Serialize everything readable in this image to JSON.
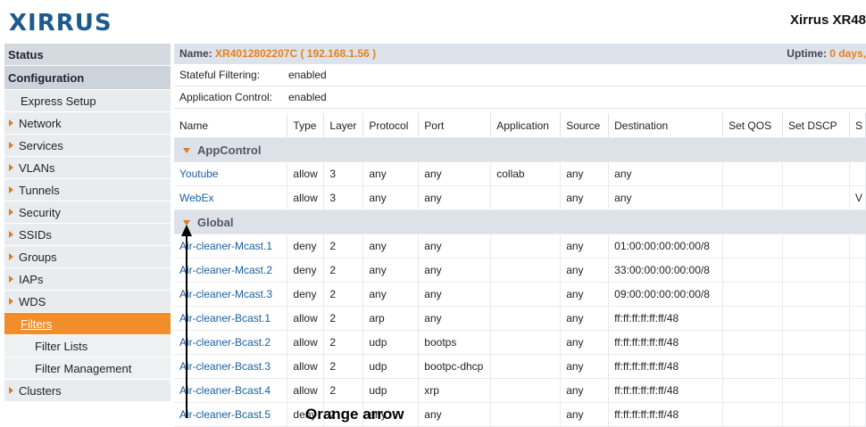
{
  "header": {
    "logo": "XIRRUS",
    "title": "Xirrus XR48"
  },
  "sidebar": {
    "status": "Status",
    "configuration": "Configuration",
    "items": [
      {
        "label": "Express Setup",
        "kind": "sub-plain"
      },
      {
        "label": "Network",
        "kind": "arrow"
      },
      {
        "label": "Services",
        "kind": "arrow"
      },
      {
        "label": "VLANs",
        "kind": "arrow"
      },
      {
        "label": "Tunnels",
        "kind": "arrow"
      },
      {
        "label": "Security",
        "kind": "arrow"
      },
      {
        "label": "SSIDs",
        "kind": "arrow"
      },
      {
        "label": "Groups",
        "kind": "arrow"
      },
      {
        "label": "IAPs",
        "kind": "arrow"
      },
      {
        "label": "WDS",
        "kind": "arrow"
      },
      {
        "label": "Filters",
        "kind": "active"
      },
      {
        "label": "Filter Lists",
        "kind": "sub"
      },
      {
        "label": "Filter Management",
        "kind": "sub"
      },
      {
        "label": "Clusters",
        "kind": "arrow"
      }
    ]
  },
  "info": {
    "name_label": "Name:",
    "name_value": "XR4012802207C",
    "ip": "( 192.168.1.56 )",
    "uptime_label": "Uptime:",
    "uptime_value": "0 days,"
  },
  "settings": [
    {
      "key": "Stateful Filtering:",
      "value": "enabled"
    },
    {
      "key": "Application Control:",
      "value": "enabled"
    }
  ],
  "table": {
    "columns": [
      "Name",
      "Type",
      "Layer",
      "Protocol",
      "Port",
      "Application",
      "Source",
      "Destination",
      "Set QOS",
      "Set DSCP",
      "S"
    ],
    "groups": [
      {
        "name": "AppControl",
        "rows": [
          [
            "Youtube",
            "allow",
            "3",
            "any",
            "any",
            "collab",
            "any",
            "any",
            "",
            "",
            ""
          ],
          [
            "WebEx",
            "allow",
            "3",
            "any",
            "any",
            "",
            "any",
            "any",
            "",
            "",
            "V"
          ]
        ]
      },
      {
        "name": "Global",
        "rows": [
          [
            "Air-cleaner-Mcast.1",
            "deny",
            "2",
            "any",
            "any",
            "",
            "any",
            "01:00:00:00:00:00/8",
            "",
            "",
            ""
          ],
          [
            "Air-cleaner-Mcast.2",
            "deny",
            "2",
            "any",
            "any",
            "",
            "any",
            "33:00:00:00:00:00/8",
            "",
            "",
            ""
          ],
          [
            "Air-cleaner-Mcast.3",
            "deny",
            "2",
            "any",
            "any",
            "",
            "any",
            "09:00:00:00:00:00/8",
            "",
            "",
            ""
          ],
          [
            "Air-cleaner-Bcast.1",
            "allow",
            "2",
            "arp",
            "any",
            "",
            "any",
            "ff:ff:ff:ff:ff:ff/48",
            "",
            "",
            ""
          ],
          [
            "Air-cleaner-Bcast.2",
            "allow",
            "2",
            "udp",
            "bootps",
            "",
            "any",
            "ff:ff:ff:ff:ff:ff/48",
            "",
            "",
            ""
          ],
          [
            "Air-cleaner-Bcast.3",
            "allow",
            "2",
            "udp",
            "bootpc-dhcp",
            "",
            "any",
            "ff:ff:ff:ff:ff:ff/48",
            "",
            "",
            ""
          ],
          [
            "Air-cleaner-Bcast.4",
            "allow",
            "2",
            "udp",
            "xrp",
            "",
            "any",
            "ff:ff:ff:ff:ff:ff/48",
            "",
            "",
            ""
          ],
          [
            "Air-cleaner-Bcast.5",
            "deny",
            "2",
            "any",
            "any",
            "",
            "any",
            "ff:ff:ff:ff:ff:ff/48",
            "",
            "",
            ""
          ]
        ]
      }
    ]
  },
  "annotation": {
    "label": "Orange arrow"
  }
}
